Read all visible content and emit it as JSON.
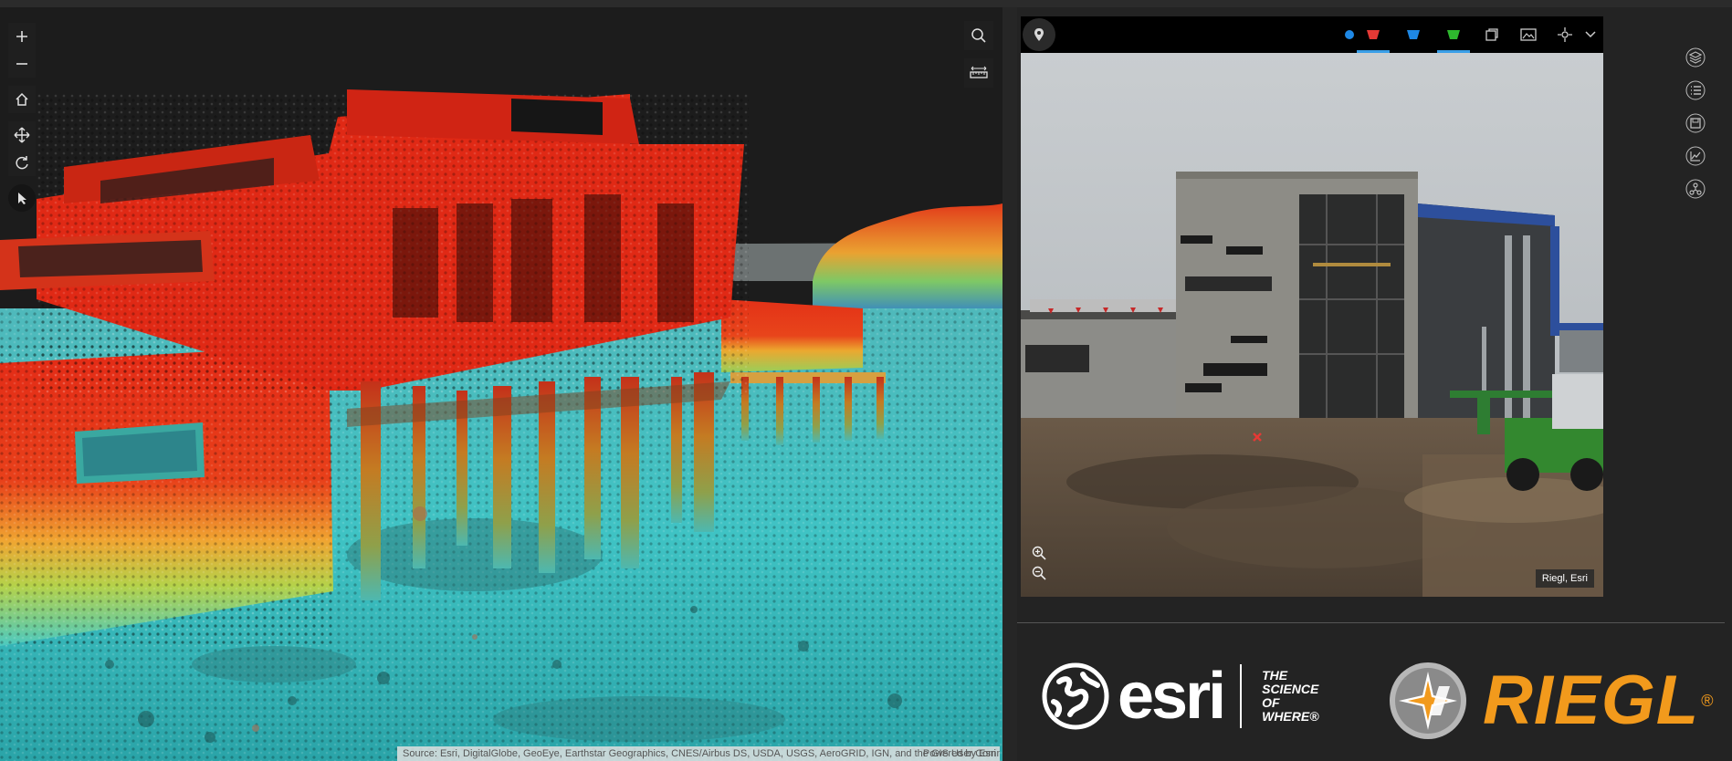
{
  "scene": {
    "attribution": "Source: Esri, DigitalGlobe, GeoEye, Earthstar Geographics, CNES/Airbus DS, USDA, USGS, AeroGRID, IGN, and the GIS User Community",
    "powered_by": "Powered by Esri",
    "nav_tools": [
      "zoom-in",
      "zoom-out",
      "home",
      "pan",
      "rotate",
      "select"
    ],
    "right_tools": [
      "search",
      "measure"
    ]
  },
  "viewer": {
    "toolbar": [
      "location-pin",
      "point-dot",
      "red-footprint",
      "blue-footprint",
      "green-footprint",
      "copy",
      "gallery",
      "crosshair",
      "collapse"
    ],
    "credit": "Riegl, Esri",
    "zoom": [
      "zoom-in",
      "zoom-out"
    ]
  },
  "rail": [
    "layers",
    "list",
    "save",
    "chart",
    "network"
  ],
  "logos": {
    "esri_word": "esri",
    "esri_tagline": [
      "THE",
      "SCIENCE",
      "OF",
      "WHERE®"
    ],
    "riegl_word": "RIEGL",
    "riegl_mark": "®"
  },
  "colors": {
    "point_cloud_high": "#e8301a",
    "point_cloud_low": "#33c4c8",
    "accent": "#3a9fe8",
    "riegl_orange": "#f29a1c"
  }
}
